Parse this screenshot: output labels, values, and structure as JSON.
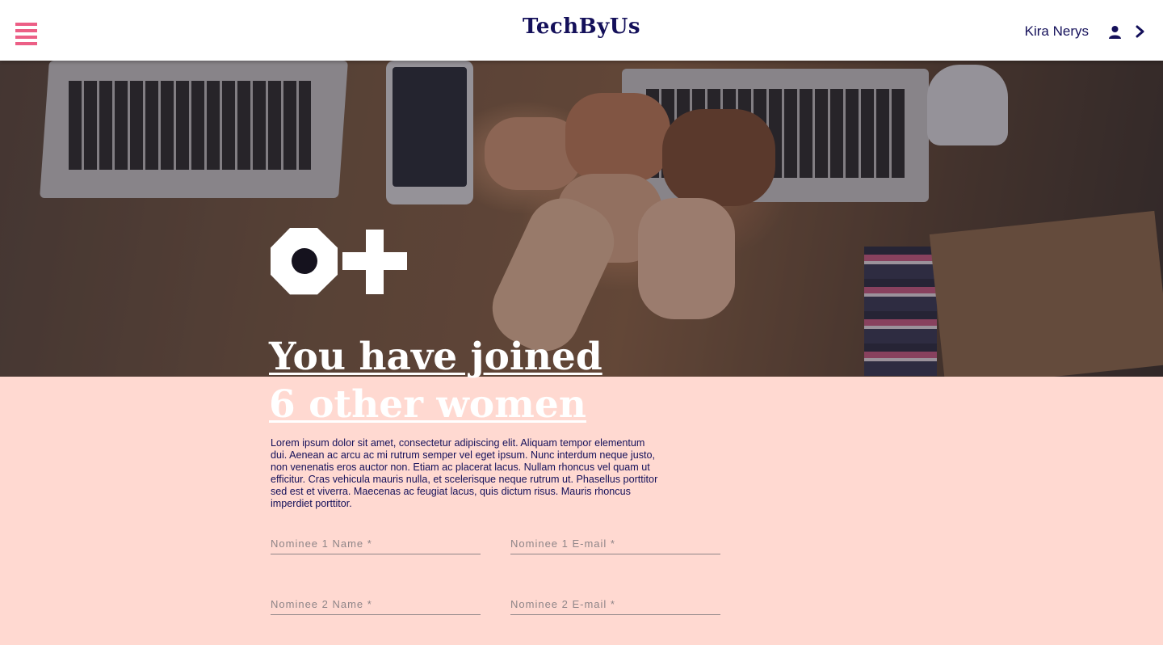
{
  "header": {
    "brand": "TechByUs",
    "user_name": "Kira Nerys",
    "menu_icon": "hamburger-menu-icon",
    "user_icon": "user-icon",
    "chevron_icon": "chevron-right-icon"
  },
  "hero": {
    "image": "hands-fist-bump-over-laptops",
    "logo_icon": "octagon-plus-logo"
  },
  "content": {
    "headline_line1": "You have joined",
    "headline_line2": "6 other women",
    "body": "Lorem ipsum dolor sit amet, consectetur adipiscing elit. Aliquam tempor elementum dui. Aenean ac arcu ac mi rutrum semper vel eget ipsum. Nunc interdum neque justo, non venenatis eros auctor non. Etiam ac placerat lacus. Nullam rhoncus vel quam ut efficitur. Cras vehicula mauris nulla, et scelerisque neque rutrum ut. Phasellus porttitor sed est et viverra. Maecenas ac feugiat lacus, quis dictum risus. Mauris rhoncus imperdiet porttitor."
  },
  "form": {
    "nominee1_name_placeholder": "Nominee 1 Name *",
    "nominee1_email_placeholder": "Nominee 1 E-mail *",
    "nominee2_name_placeholder": "Nominee 2 Name *",
    "nominee2_email_placeholder": "Nominee 2 E-mail *"
  },
  "colors": {
    "navy": "#14105a",
    "pink_accent": "#ec5f86",
    "background": "#ffd9d1"
  }
}
